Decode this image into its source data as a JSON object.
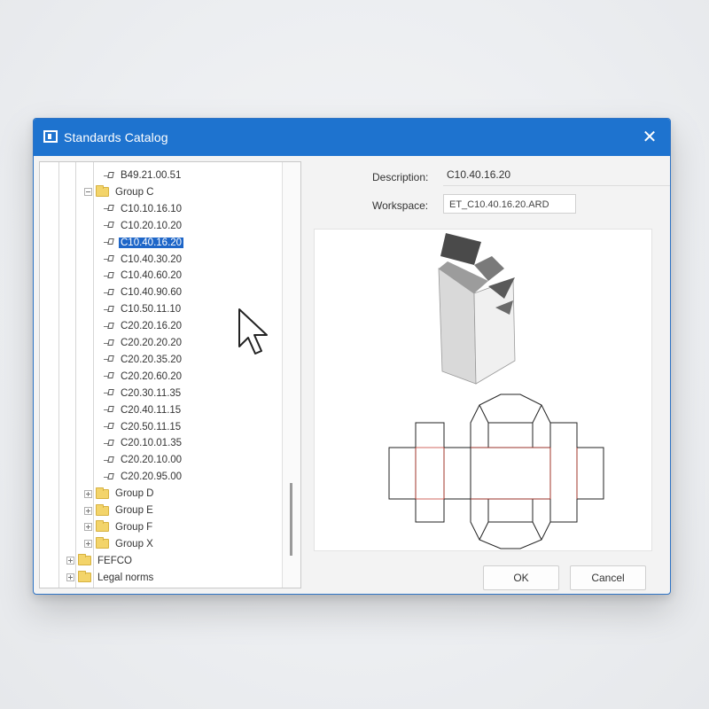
{
  "window": {
    "title": "Standards Catalog",
    "close_glyph": "✕"
  },
  "tree": {
    "items": [
      {
        "type": "item",
        "label": "B49.21.00.51",
        "indent": 2
      },
      {
        "type": "group",
        "label": "Group C",
        "indent": 1,
        "expanded": true
      },
      {
        "type": "item",
        "label": "C10.10.16.10",
        "indent": 2
      },
      {
        "type": "item",
        "label": "C10.20.10.20",
        "indent": 2
      },
      {
        "type": "item",
        "label": "C10.40.16.20",
        "indent": 2,
        "selected": true
      },
      {
        "type": "item",
        "label": "C10.40.30.20",
        "indent": 2
      },
      {
        "type": "item",
        "label": "C10.40.60.20",
        "indent": 2
      },
      {
        "type": "item",
        "label": "C10.40.90.60",
        "indent": 2
      },
      {
        "type": "item",
        "label": "C10.50.11.10",
        "indent": 2
      },
      {
        "type": "item",
        "label": "C20.20.16.20",
        "indent": 2
      },
      {
        "type": "item",
        "label": "C20.20.20.20",
        "indent": 2
      },
      {
        "type": "item",
        "label": "C20.20.35.20",
        "indent": 2
      },
      {
        "type": "item",
        "label": "C20.20.60.20",
        "indent": 2
      },
      {
        "type": "item",
        "label": "C20.30.11.35",
        "indent": 2
      },
      {
        "type": "item",
        "label": "C20.40.11.15",
        "indent": 2
      },
      {
        "type": "item",
        "label": "C20.50.11.15",
        "indent": 2
      },
      {
        "type": "item",
        "label": "C20.10.01.35",
        "indent": 2
      },
      {
        "type": "item",
        "label": "C20.20.10.00",
        "indent": 2
      },
      {
        "type": "item",
        "label": "C20.20.95.00",
        "indent": 2
      },
      {
        "type": "group",
        "label": "Group D",
        "indent": 1,
        "expanded": false
      },
      {
        "type": "group",
        "label": "Group E",
        "indent": 1,
        "expanded": false
      },
      {
        "type": "group",
        "label": "Group F",
        "indent": 1,
        "expanded": false
      },
      {
        "type": "group",
        "label": "Group X",
        "indent": 1,
        "expanded": false
      },
      {
        "type": "group",
        "label": "FEFCO",
        "indent": 0,
        "expanded": false
      },
      {
        "type": "group",
        "label": "Legal norms",
        "indent": 0,
        "expanded": false
      }
    ]
  },
  "details": {
    "description_label": "Description:",
    "description_value": "C10.40.16.20",
    "workspace_label": "Workspace:",
    "workspace_value": "ET_C10.40.16.20.ARD"
  },
  "buttons": {
    "ok": "OK",
    "cancel": "Cancel"
  },
  "colors": {
    "titlebar": "#1e73cf",
    "selection": "#1e66c8",
    "crease_line": "#c0392b"
  },
  "icons": {
    "title": "catalog-icon",
    "close": "close-icon",
    "folder": "folder-icon",
    "item": "standard-item-icon"
  }
}
